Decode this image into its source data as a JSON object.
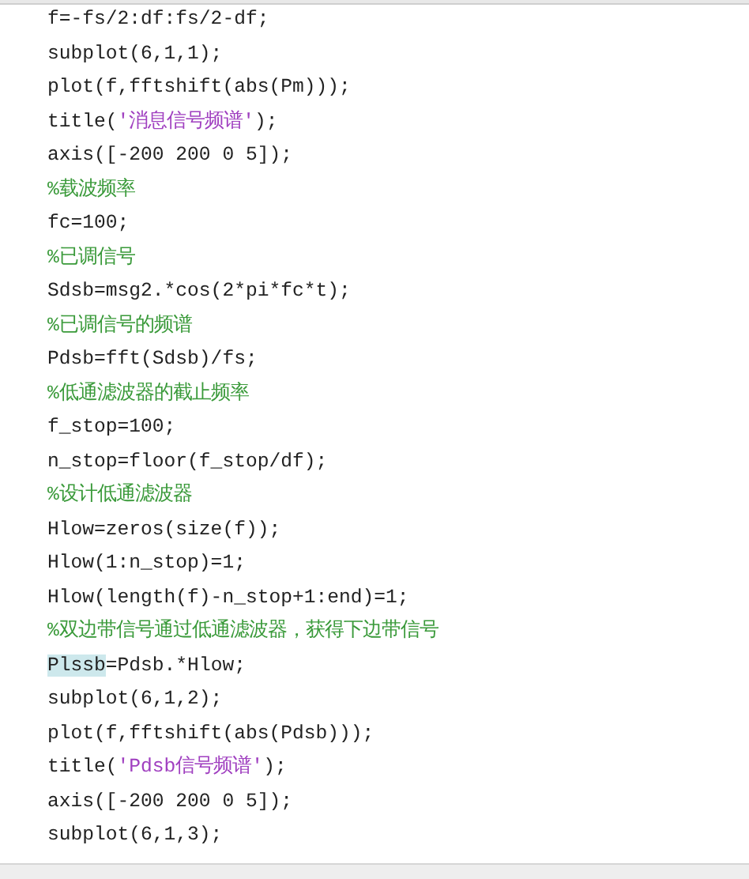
{
  "editor": {
    "lines": [
      {
        "parts": [
          {
            "text": "f=-fs/2:df:fs/2-df;",
            "kind": "code"
          }
        ]
      },
      {
        "parts": [
          {
            "text": "subplot(6,1,1);",
            "kind": "code"
          }
        ]
      },
      {
        "parts": [
          {
            "text": "plot(f,fftshift(abs(Pm)));",
            "kind": "code"
          }
        ]
      },
      {
        "parts": [
          {
            "text": "title(",
            "kind": "code"
          },
          {
            "text": "'消息信号频谱'",
            "kind": "string"
          },
          {
            "text": ");",
            "kind": "code"
          }
        ]
      },
      {
        "parts": [
          {
            "text": "axis([-200 200 0 5]);",
            "kind": "code"
          }
        ]
      },
      {
        "parts": [
          {
            "text": "%载波频率",
            "kind": "comment"
          }
        ]
      },
      {
        "parts": [
          {
            "text": "fc=100;",
            "kind": "code"
          }
        ]
      },
      {
        "parts": [
          {
            "text": "%已调信号",
            "kind": "comment"
          }
        ]
      },
      {
        "parts": [
          {
            "text": "Sdsb=msg2.*cos(2*pi*fc*t);",
            "kind": "code"
          }
        ]
      },
      {
        "parts": [
          {
            "text": "%已调信号的频谱",
            "kind": "comment"
          }
        ]
      },
      {
        "parts": [
          {
            "text": "Pdsb=fft(Sdsb)/fs;",
            "kind": "code"
          }
        ]
      },
      {
        "parts": [
          {
            "text": "%低通滤波器的截止频率",
            "kind": "comment"
          }
        ]
      },
      {
        "parts": [
          {
            "text": "f_stop=100;",
            "kind": "code"
          }
        ]
      },
      {
        "parts": [
          {
            "text": "n_stop=floor(f_stop/df);",
            "kind": "code"
          }
        ]
      },
      {
        "parts": [
          {
            "text": "%设计低通滤波器",
            "kind": "comment"
          }
        ]
      },
      {
        "parts": [
          {
            "text": "Hlow=zeros(size(f));",
            "kind": "code"
          }
        ]
      },
      {
        "parts": [
          {
            "text": "Hlow(1:n_stop)=1;",
            "kind": "code"
          }
        ]
      },
      {
        "parts": [
          {
            "text": "Hlow(length(f)-n_stop+1:end)=1;",
            "kind": "code"
          }
        ]
      },
      {
        "parts": [
          {
            "text": "%双边带信号通过低通滤波器，获得下边带信号",
            "kind": "comment"
          }
        ]
      },
      {
        "parts": [
          {
            "text": "Plssb",
            "kind": "highlight"
          },
          {
            "text": "=Pdsb.*Hlow;",
            "kind": "code"
          }
        ]
      },
      {
        "parts": [
          {
            "text": "subplot(6,1,2);",
            "kind": "code"
          }
        ]
      },
      {
        "parts": [
          {
            "text": "plot(f,fftshift(abs(Pdsb)));",
            "kind": "code"
          }
        ]
      },
      {
        "parts": [
          {
            "text": "title(",
            "kind": "code"
          },
          {
            "text": "'Pdsb信号频谱'",
            "kind": "string"
          },
          {
            "text": ");",
            "kind": "code"
          }
        ]
      },
      {
        "parts": [
          {
            "text": "axis([-200 200 0 5]);",
            "kind": "code"
          }
        ]
      },
      {
        "parts": [
          {
            "text": "subplot(6,1,3);",
            "kind": "code"
          }
        ]
      }
    ]
  }
}
